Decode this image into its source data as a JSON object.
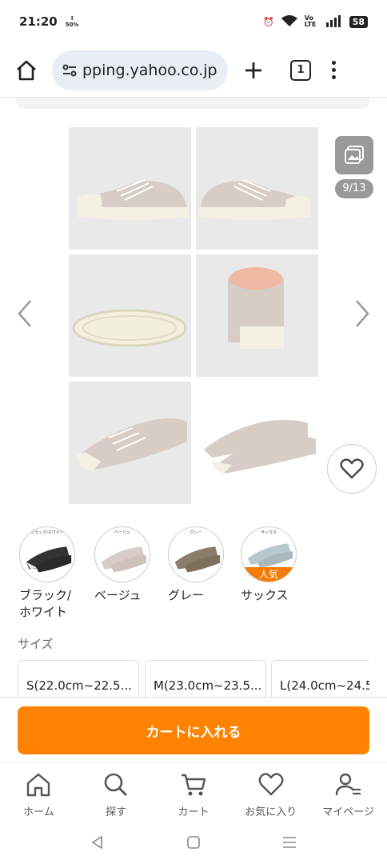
{
  "status": {
    "time": "21:20",
    "rate": "50%",
    "vo_lte": "Vo LTE",
    "battery": "58"
  },
  "browser": {
    "url": "pping.yahoo.co.jp",
    "tab_count": "1"
  },
  "gallery": {
    "counter": "9/13"
  },
  "colors": [
    {
      "label_line1": "ブラック/",
      "label_line2": "ホワイト",
      "tiny": "ブラック/ホワイト",
      "popular": ""
    },
    {
      "label_line1": "ベージュ",
      "label_line2": "",
      "tiny": "ベージュ",
      "popular": ""
    },
    {
      "label_line1": "グレー",
      "label_line2": "",
      "tiny": "グレー",
      "popular": ""
    },
    {
      "label_line1": "サックス",
      "label_line2": "",
      "tiny": "サックス",
      "popular": "人気"
    }
  ],
  "size": {
    "label": "サイズ",
    "options": [
      "S(22.0cm~22.5...",
      "M(23.0cm~23.5...",
      "L(24.0cm~24.5"
    ]
  },
  "cart": {
    "button_label": "カートに入れる"
  },
  "nav": {
    "home": "ホーム",
    "search": "探す",
    "cart": "カート",
    "favorites": "お気に入り",
    "mypage": "マイページ"
  },
  "theme": {
    "accent": "#ff8200",
    "popular": "#f57c00"
  }
}
